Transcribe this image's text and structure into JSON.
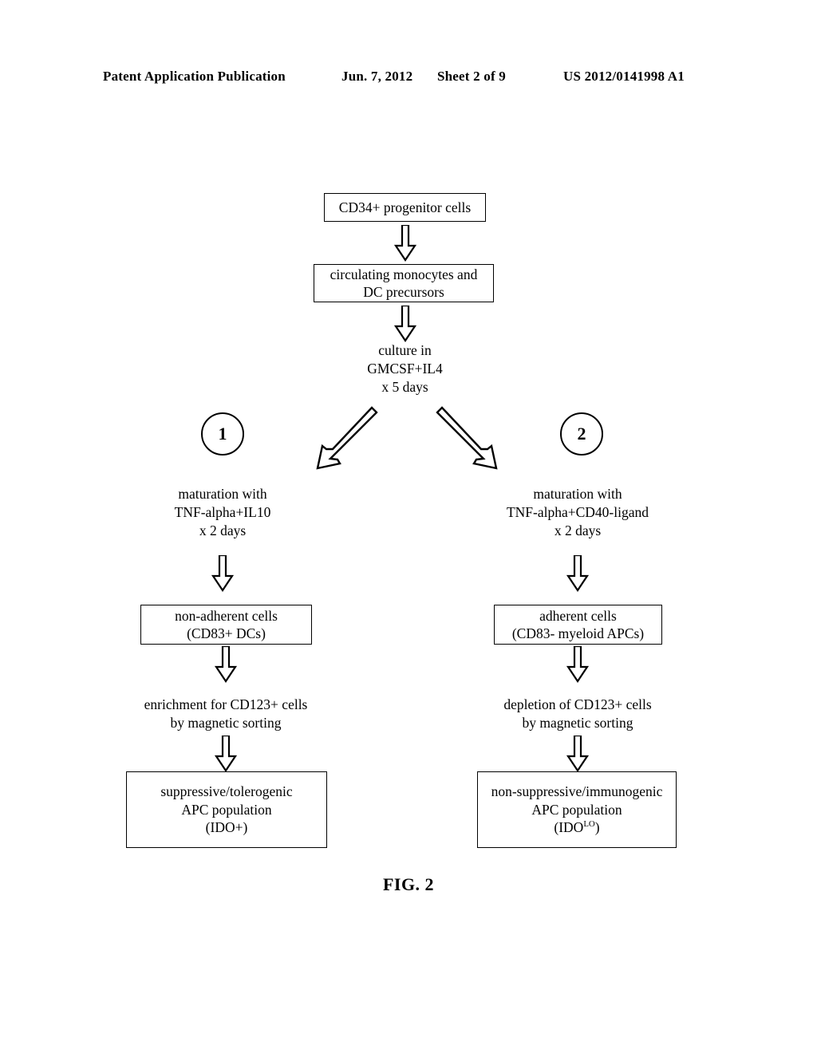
{
  "header": {
    "publication": "Patent Application Publication",
    "date": "Jun. 7, 2012",
    "sheet": "Sheet 2 of 9",
    "pub_number": "US 2012/0141998 A1"
  },
  "figure": {
    "caption": "FIG. 2",
    "nodes": {
      "progenitor": "CD34+ progenitor cells",
      "precursors_line1": "circulating monocytes and",
      "precursors_line2": "DC precursors",
      "culture_line1": "culture in",
      "culture_line2": "GMCSF+IL4",
      "culture_line3": "x 5 days",
      "branch1_number": "1",
      "branch2_number": "2",
      "maturation_left_line1": "maturation with",
      "maturation_left_line2": "TNF-alpha+IL10",
      "maturation_left_line3": "x 2 days",
      "maturation_right_line1": "maturation with",
      "maturation_right_line2": "TNF-alpha+CD40-ligand",
      "maturation_right_line3": "x 2 days",
      "cells_left_line1": "non-adherent cells",
      "cells_left_line2": "(CD83+ DCs)",
      "cells_right_line1": "adherent cells",
      "cells_right_line2": "(CD83- myeloid APCs)",
      "sorting_left_line1": "enrichment for CD123+ cells",
      "sorting_left_line2": "by magnetic sorting",
      "sorting_right_line1": "depletion of CD123+ cells",
      "sorting_right_line2": "by magnetic sorting",
      "outcome_left_line1": "suppressive/tolerogenic",
      "outcome_left_line2": "APC population",
      "outcome_left_line3": "(IDO+)",
      "outcome_right_line1": "non-suppressive/immunogenic",
      "outcome_right_line2": "APC population",
      "outcome_right_line3_prefix": "(IDO",
      "outcome_right_line3_sup": "LO",
      "outcome_right_line3_suffix": ")"
    },
    "colors": {
      "ink": "#000000",
      "paper": "#ffffff"
    }
  }
}
